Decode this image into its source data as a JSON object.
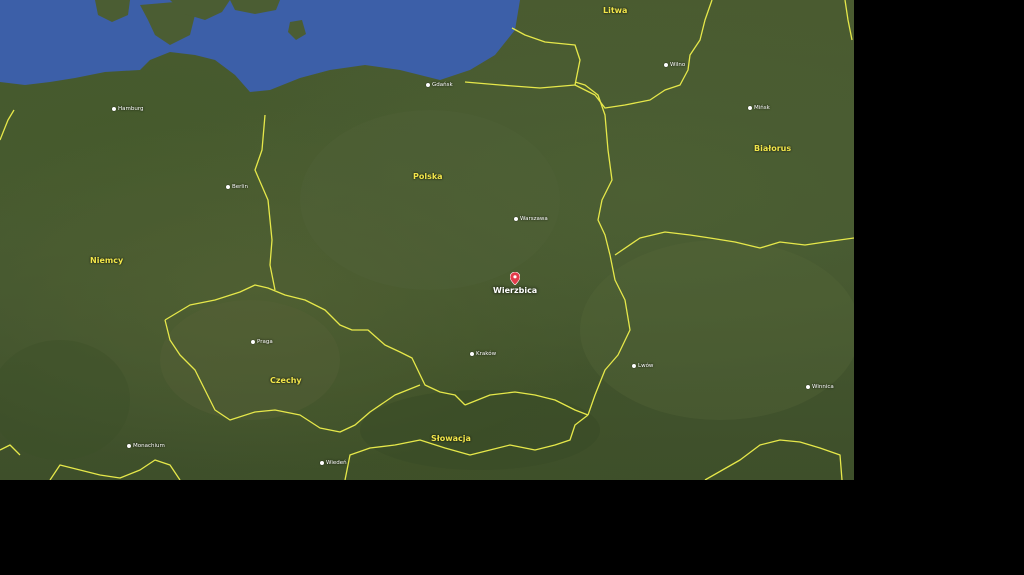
{
  "map": {
    "countries": {
      "litwa": "Litwa",
      "bialorus": "Białorus",
      "polska": "Polska",
      "niemcy": "Niemcy",
      "czechy": "Czechy",
      "slowacja": "Słowacja"
    },
    "cities": {
      "gdansk": "Gdańsk",
      "hamburg": "Hamburg",
      "berlin": "Berlin",
      "warszawa": "Warszawa",
      "wilno": "Wilno",
      "minsk": "Mińsk",
      "praga": "Praga",
      "krakow": "Kraków",
      "lwow": "Lwów",
      "monachium": "Monachium",
      "wieden": "Wiedeń",
      "winnica": "Winnica"
    },
    "pin": {
      "label": "Wierzbica",
      "icon": "map-pin-icon",
      "color": "#e23b4a"
    },
    "colors": {
      "border": "#e6e84a",
      "sea": "#3c5fa8",
      "land": "#4a5b30"
    }
  }
}
